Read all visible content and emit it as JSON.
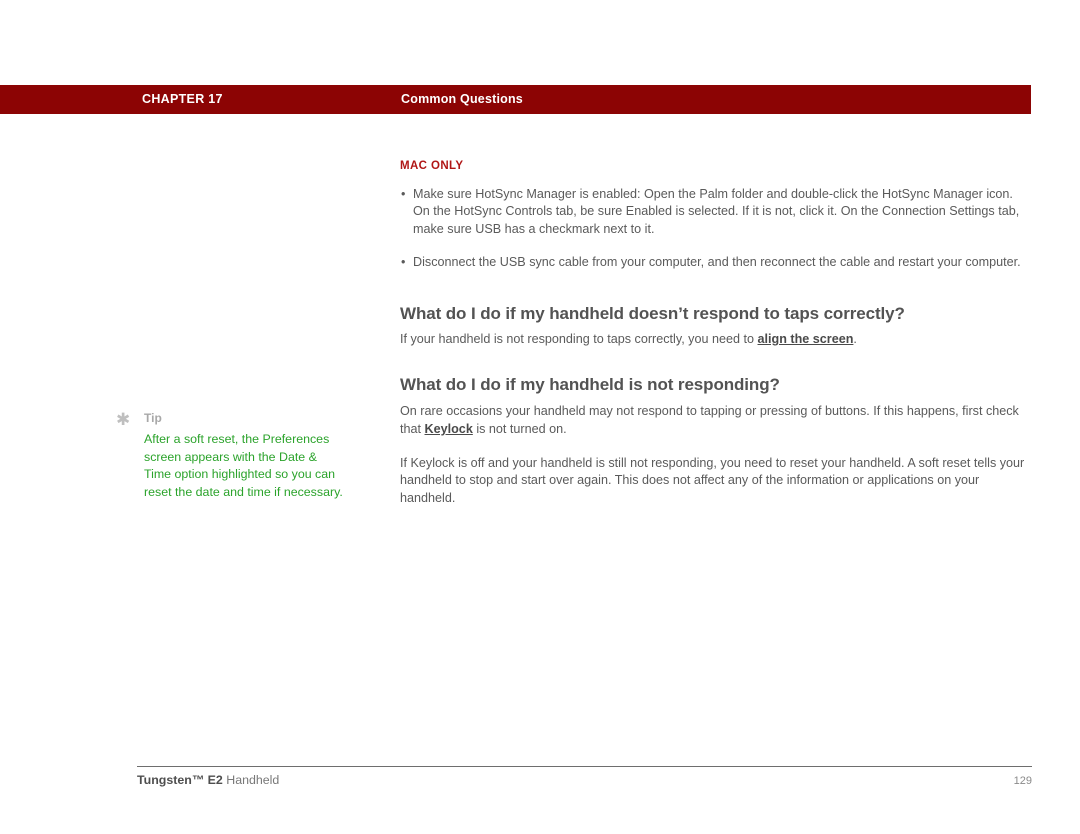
{
  "header": {
    "chapter_label": "CHAPTER 17",
    "section_title": "Common Questions",
    "bar_color": "#8C0404"
  },
  "main": {
    "kicker": "MAC ONLY",
    "kicker_color": "#B01616",
    "bullets": [
      {
        "marker": "•",
        "text": "Make sure HotSync Manager is enabled: Open the Palm folder and double-click the HotSync Manager icon. On the HotSync Controls tab, be sure Enabled is selected. If it is not, click it. On the Connection Settings tab, make sure USB has a checkmark next to it."
      },
      {
        "marker": "•",
        "text": "Disconnect the USB sync cable from your computer, and then reconnect the cable and restart your computer."
      }
    ],
    "sections": [
      {
        "heading": "What do I do if my handheld doesn’t respond to taps correctly?",
        "para_before_link": "If your handheld is not responding to taps correctly, you need to ",
        "link_text": "align the screen",
        "para_after_link": "."
      },
      {
        "heading": "What do I do if my handheld is not responding?",
        "para1_before_link": "On rare occasions your handheld may not respond to tapping or pressing of buttons. If this happens, first check that ",
        "link_text": "Keylock",
        "para1_after_link": " is not turned on.",
        "para2": "If Keylock is off and your handheld is still not responding, you need to reset your handheld. A soft reset tells your handheld to stop and start over again. This does not affect any of the information or applications on your handheld."
      }
    ]
  },
  "tip": {
    "icon": "asterisk-icon",
    "icon_glyph": "✱",
    "label": "Tip",
    "text": "After a soft reset, the Preferences screen appears with the Date & Time option highlighted so you can reset the date and time if necessary.",
    "text_color": "#2BA32B"
  },
  "footer": {
    "brand": "Tungsten™ E2",
    "product": " Handheld",
    "page_number": "129"
  }
}
